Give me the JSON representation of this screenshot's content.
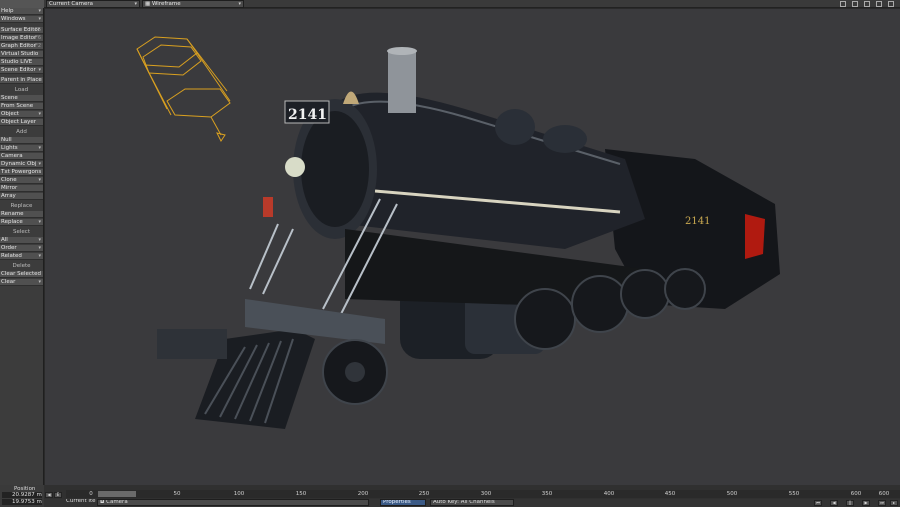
{
  "top": {
    "camera_view": "Current Camera",
    "render_mode": "Wireframe"
  },
  "left": {
    "top_buttons": [
      {
        "label": "Help",
        "shortcut": ""
      },
      {
        "label": "Windows",
        "shortcut": ""
      },
      {
        "label": "Surface Editor",
        "shortcut": "F5"
      },
      {
        "label": "Image Editor",
        "shortcut": "F6"
      },
      {
        "label": "Graph Editor",
        "shortcut": "F2"
      },
      {
        "label": "Virtual Studio",
        "shortcut": ""
      },
      {
        "label": "Studio LIVE",
        "shortcut": ""
      },
      {
        "label": "Scene Editor",
        "shortcut": ""
      },
      {
        "label": "Parent in Place",
        "shortcut": ""
      }
    ],
    "load_header": "Load",
    "load_buttons": [
      "Scene",
      "From Scene",
      "Object",
      "Object Layer"
    ],
    "add_header": "Add",
    "add_buttons": [
      "Null",
      "Lights",
      "Camera",
      "Dynamic Obj",
      "Txt Powergons",
      "Clone",
      "Mirror",
      "Array"
    ],
    "replace_header": "Replace",
    "replace_buttons": [
      "Rename",
      "Replace"
    ],
    "select_header": "Select",
    "select_buttons": [
      "All",
      "Order",
      "Related"
    ],
    "delete_header": "Delete",
    "delete_buttons": [
      "Clear Selected",
      "Clear"
    ]
  },
  "bottom": {
    "position_label": "Position",
    "position_x": "20.9287 m",
    "position_y": "19.9753 m",
    "current_item_label": "Current Item",
    "current_item": "Camera",
    "properties": "Properties",
    "auto_key": "Auto Key: All Channels",
    "ticks": [
      "0",
      "50",
      "100",
      "150",
      "200",
      "250",
      "300",
      "350",
      "400",
      "450",
      "500",
      "550",
      "600",
      "600"
    ]
  },
  "scene": {
    "locomotive_number": "2141",
    "tender_number": "2141"
  }
}
